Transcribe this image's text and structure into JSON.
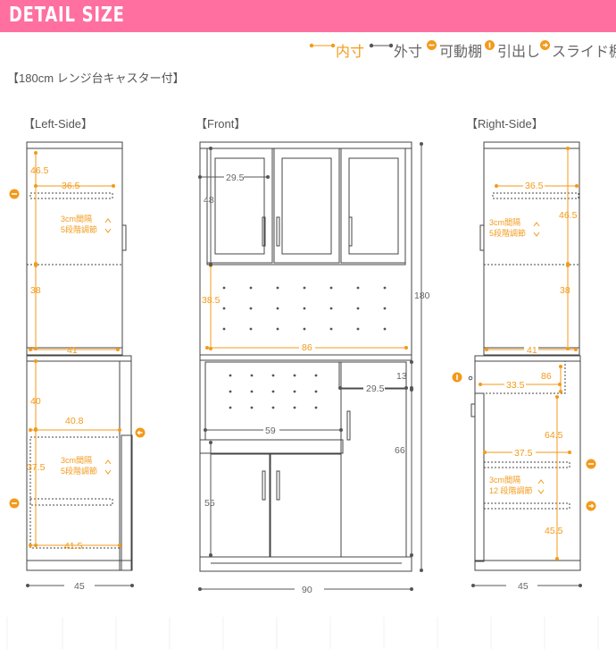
{
  "header": {
    "title": "DETAIL SIZE"
  },
  "legend": {
    "inner": "内寸",
    "outer": "外寸",
    "adjustable_shelf": "可動棚",
    "drawer": "引出し",
    "slide_shelf": "スライド棚"
  },
  "subtitle": "【180cm レンジ台キャスター付】",
  "views": {
    "left_label": "【Left-Side】",
    "front_label": "【Front】",
    "right_label": "【Right-Side】"
  },
  "left_dims": {
    "d1": "46.5",
    "d2": "36.5",
    "d3": "38",
    "d4": "41",
    "d5": "40",
    "d6": "40.8",
    "d7": "37.5",
    "d8": "41.5",
    "d9": "45",
    "note1a": "3cm間隔",
    "note1b": "5段階調節",
    "note2a": "3cm間隔",
    "note2b": "5段階調節"
  },
  "front_dims": {
    "d1": "29.5",
    "d2": "48",
    "d3": "38.5",
    "d4": "86",
    "d5": "13",
    "d6": "29.5",
    "d7": "59",
    "d8": "66",
    "d9": "55",
    "d10": "180",
    "d11": "90"
  },
  "right_dims": {
    "d1": "36.5",
    "d2": "46.5",
    "d3": "38",
    "d4": "41",
    "d5": "86",
    "d6": "33.5",
    "d7": "64.5",
    "d8": "37.5",
    "d9": "45.5",
    "d10": "45",
    "note1a": "3cm間隔",
    "note1b": "5段階調節",
    "note2a": "3cm間隔",
    "note2b": "12 段階調節"
  },
  "colors": {
    "banner": "#ff6fa0",
    "inner": "#f39a1a",
    "outer": "#555555",
    "line": "#444444"
  }
}
